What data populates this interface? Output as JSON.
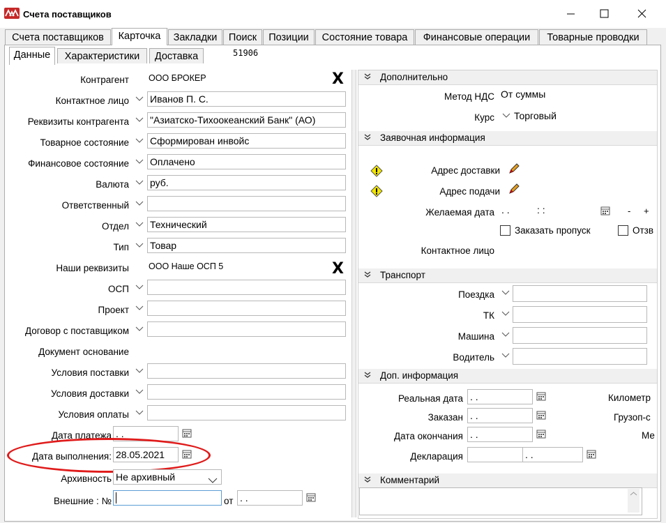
{
  "window": {
    "title": "Счета поставщиков"
  },
  "tabs": [
    "Счета поставщиков",
    "Карточка",
    "Закладки",
    "Поиск",
    "Позиции",
    "Состояние товара",
    "Финансовые операции",
    "Товарные проводки"
  ],
  "subtabs": [
    "Данные",
    "Характеристики",
    "Доставка"
  ],
  "doc_number": "51906",
  "left": {
    "kontragent_label": "Контрагент",
    "kontragent_value": "ООО БРОКЕР",
    "contact_label": "Контактное лицо",
    "contact_value": "Иванов П. С.",
    "rekv_label": "Реквизиты контрагента",
    "rekv_value": "\"Азиатско-Тихоокеанский Банк\" (АО)",
    "tov_label": "Товарное состояние",
    "tov_value": "Сформирован инвойс",
    "fin_label": "Финансовое состояние",
    "fin_value": "Оплачено",
    "val_label": "Валюта",
    "val_value": "руб.",
    "resp_label": "Ответственный",
    "resp_value": "",
    "otdel_label": "Отдел",
    "otdel_value": "Технический",
    "type_label": "Тип",
    "type_value": "Товар",
    "our_label": "Наши реквизиты",
    "our_value": "ООО Наше ОСП 5",
    "osp_label": "ОСП",
    "osp_value": "",
    "proj_label": "Проект",
    "proj_value": "",
    "dogovor_label": "Договор с поставщиком",
    "dogovor_value": "",
    "docosn_label": "Документ основание",
    "usl_post_label": "Условия поставки",
    "usl_post_value": "",
    "usl_dost_label": "Условия доставки",
    "usl_dost_value": "",
    "usl_opl_label": "Условия оплаты",
    "usl_opl_value": "",
    "pay_date_label": "Дата платежа",
    "pay_date_value": ". .",
    "exec_date_label": "Дата выполнения:",
    "exec_date_value": "28.05.2021",
    "arch_label": "Архивность",
    "arch_value": "Не архивный",
    "ext_label": "Внешние : №",
    "ext_value": "",
    "ot_label": "от",
    "ot_value": ". ."
  },
  "right": {
    "dop_header": "Дополнительно",
    "nds_label": "Метод НДС",
    "nds_value": "От суммы",
    "kurs_label": "Курс",
    "kurs_value": "Торговый",
    "zayav_header": "Заявочная информация",
    "addr_dost_label": "Адрес доставки",
    "addr_pod_label": "Адрес подачи",
    "want_date_label": "Желаемая дата",
    "want_date_value": ". .",
    "want_time_value": ":  :",
    "minus": "-",
    "plus": "+",
    "order_pass_label": "Заказать пропуск",
    "otzv_label": "Отзв",
    "contact2_label": "Контактное лицо",
    "transport_header": "Транспорт",
    "poezdka_label": "Поездка",
    "tk_label": "ТК",
    "mashina_label": "Машина",
    "voditel_label": "Водитель",
    "dopinfo_header": "Доп. информация",
    "real_date_label": "Реальная дата",
    "real_date_value": ". .",
    "zakazan_label": "Заказан",
    "zakazan_value": ". .",
    "end_date_label": "Дата окончания",
    "end_date_value": ". .",
    "decl_label": "Декларация",
    "decl_value": ". .",
    "km_label": "Километр",
    "gruz_label": "Грузоп-с",
    "me_label": "Ме",
    "comment_header": "Комментарий"
  }
}
